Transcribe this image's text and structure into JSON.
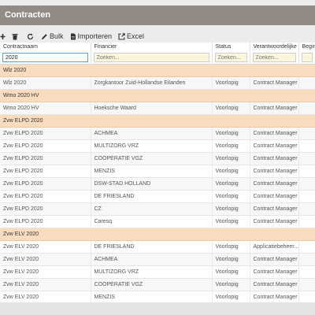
{
  "window": {
    "title": "Contracten"
  },
  "toolbar": {
    "bulk_label": "Bulk",
    "import_label": "Importeren",
    "excel_label": "Excel"
  },
  "columns": [
    "Contractnaam",
    "Financier",
    "Status",
    "Verantwoordelijke",
    "Beginda"
  ],
  "filters": {
    "contractnaam_value": "2020",
    "placeholder": "Zoeken..."
  },
  "groups": [
    {
      "label": "Wlz 2020",
      "rows": [
        [
          "Wlz 2020",
          "Zorgkantoor Zuid-Hollandse Eilanden",
          "Voorlopig",
          "Contract Manager"
        ]
      ]
    },
    {
      "label": "Wmo 2020 HV",
      "rows": [
        [
          "Wmo 2020 HV",
          "Hoeksche Waard",
          "Voorlopig",
          "Contract Manager"
        ]
      ]
    },
    {
      "label": "Zvw ELPD 2020",
      "rows": [
        [
          "Zvw ELPD 2020",
          "ACHMEA",
          "Voorlopig",
          "Contract Manager"
        ],
        [
          "Zvw ELPD 2020",
          "MULTIZORG VRZ",
          "Voorlopig",
          "Contract Manager"
        ],
        [
          "Zvw ELPD 2020",
          "COOPERATIE VGZ",
          "Voorlopig",
          "Contract Manager"
        ],
        [
          "Zvw ELPD 2020",
          "MENZIS",
          "Voorlopig",
          "Contract Manager"
        ],
        [
          "Zvw ELPD 2020",
          "DSW-STAD HOLLAND",
          "Voorlopig",
          "Contract Manager"
        ],
        [
          "Zvw ELPD 2020",
          "DE FRIESLAND",
          "Voorlopig",
          "Contract Manager"
        ],
        [
          "Zvw ELPD 2020",
          "CZ",
          "Voorlopig",
          "Contract Manager"
        ],
        [
          "Zvw ELPD 2020",
          "Caresq",
          "Voorlopig",
          "Contract Manager"
        ]
      ]
    },
    {
      "label": "Zvw ELV 2020",
      "rows": [
        [
          "Zvw ELV 2020",
          "DE FRIESLAND",
          "Voorlopig",
          "Applicatiebeheer..."
        ],
        [
          "Zvw ELV 2020",
          "ACHMEA",
          "Voorlopig",
          "Contract Manager"
        ],
        [
          "Zvw ELV 2020",
          "MULTIZORG VRZ",
          "Voorlopig",
          "Contract Manager"
        ],
        [
          "Zvw ELV 2020",
          "COOPERATIE VGZ",
          "Voorlopig",
          "Contract Manager"
        ],
        [
          "Zvw ELV 2020",
          "MENZIS",
          "Voorlopig",
          "Contract Manager"
        ]
      ]
    }
  ],
  "colors": {
    "titlebar": "#928b84",
    "group_row": "#f9dcbe",
    "filter_input": "#fbf5dc"
  },
  "icons": [
    "add-icon",
    "delete-icon",
    "refresh-icon",
    "pencil-icon",
    "document-icon",
    "export-icon"
  ]
}
